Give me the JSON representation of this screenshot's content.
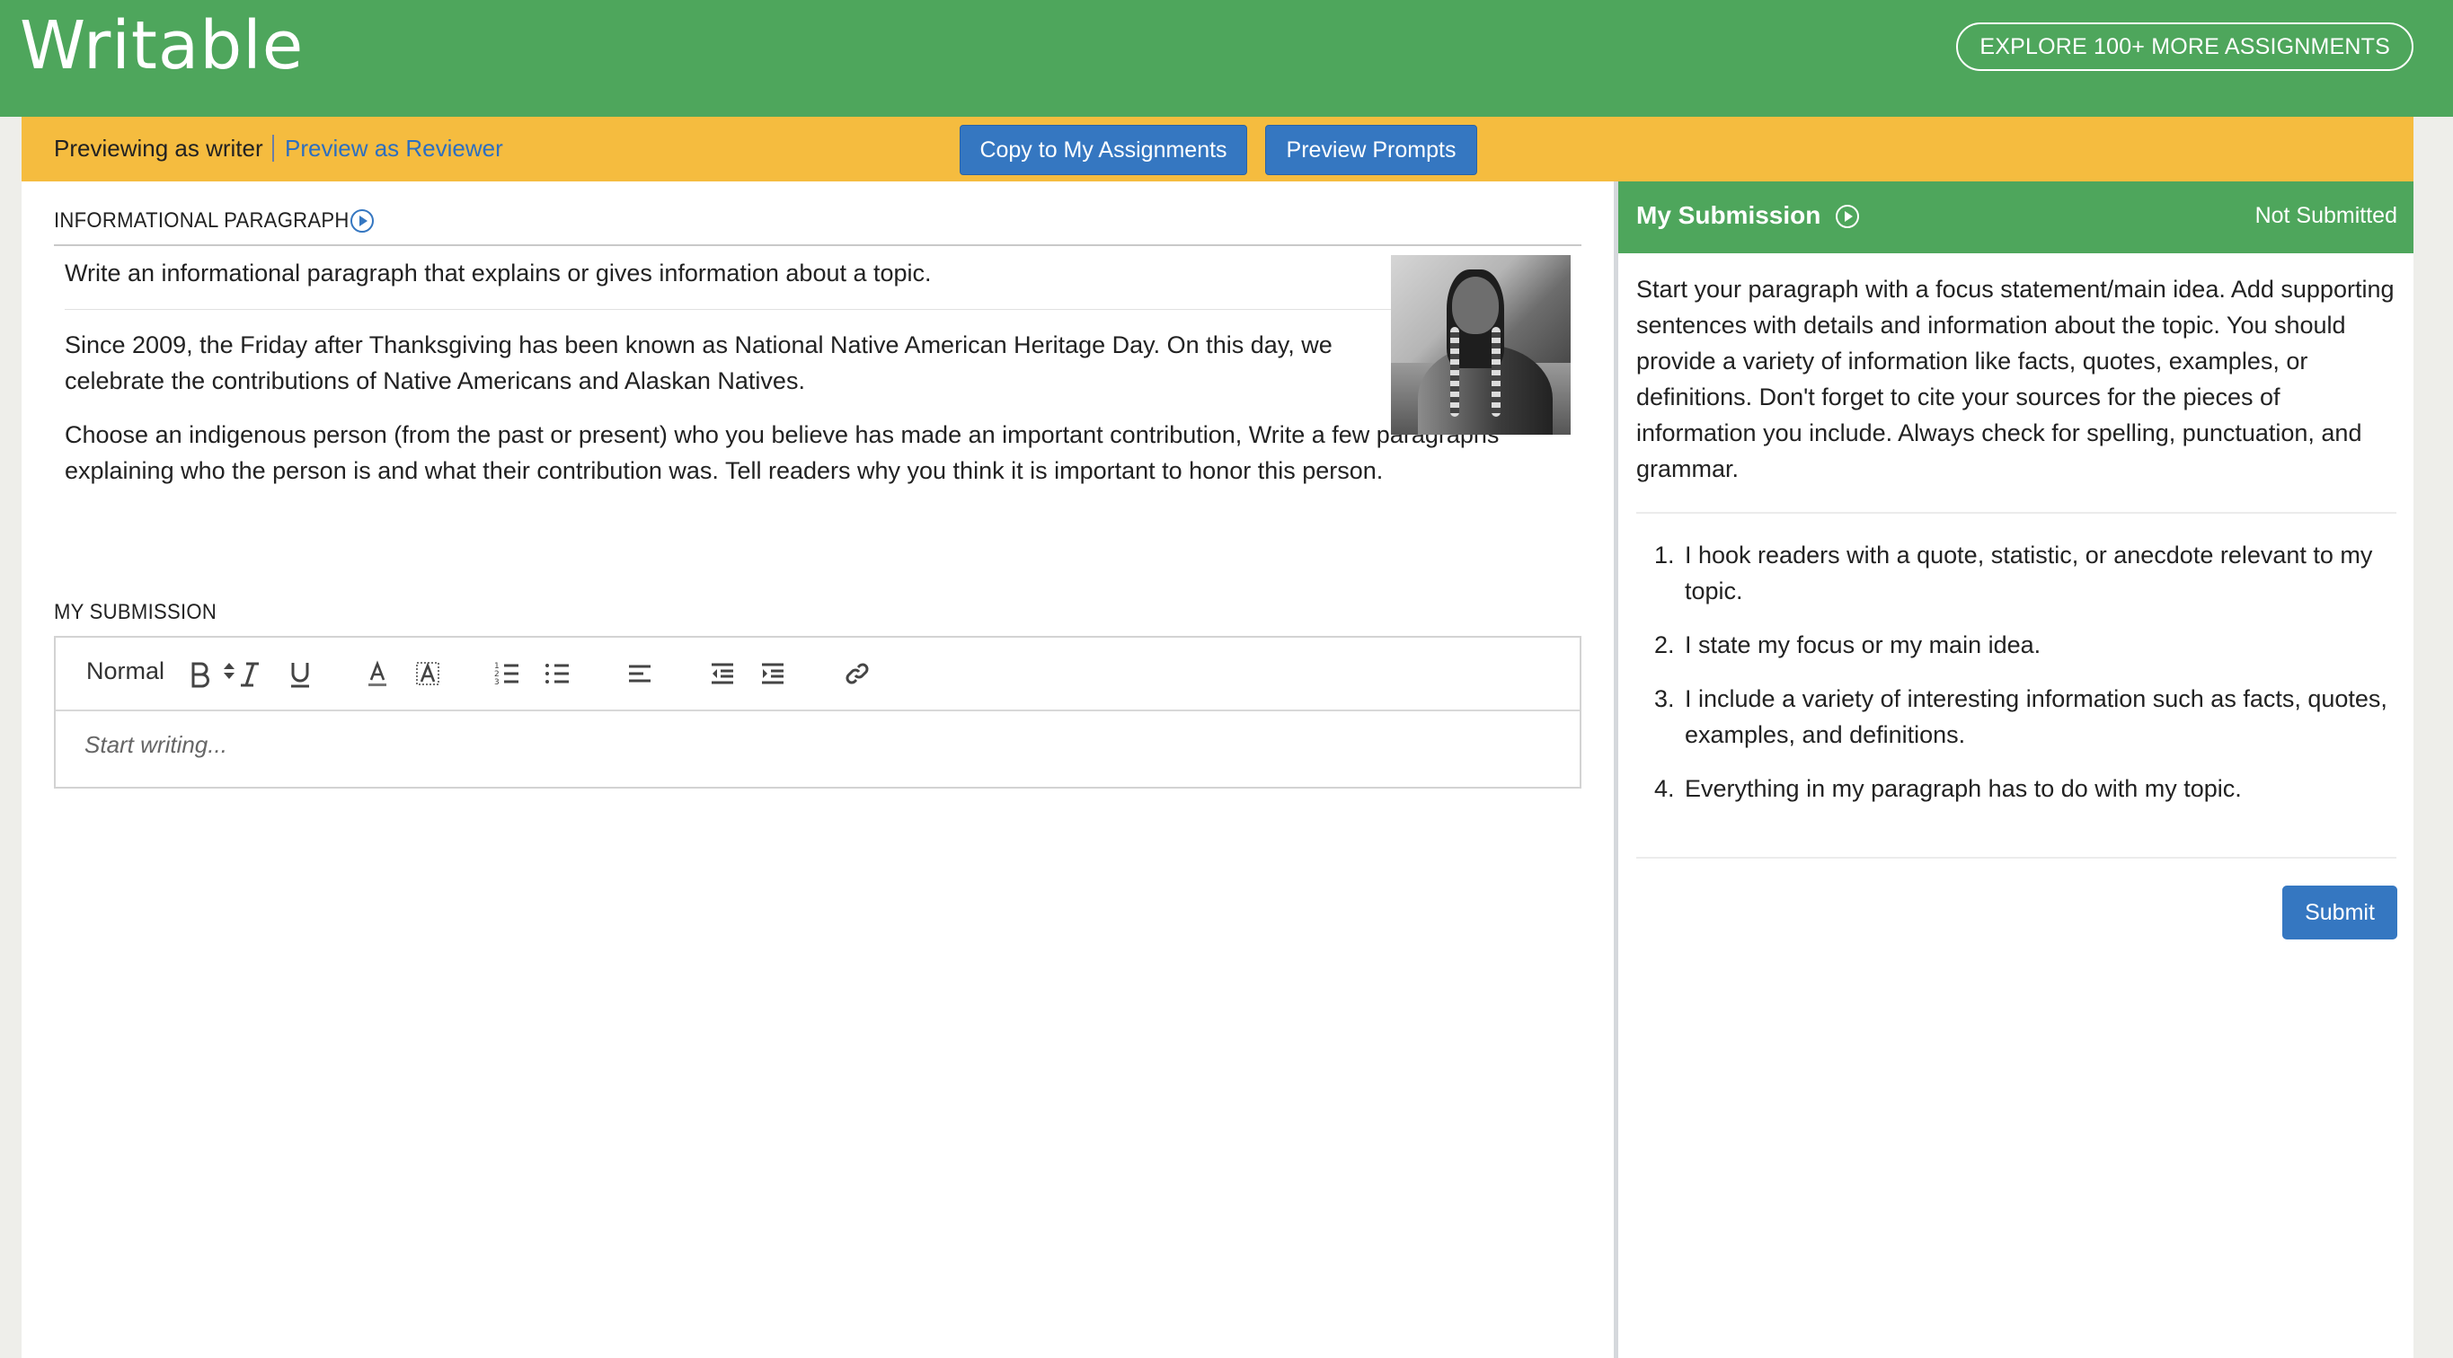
{
  "header": {
    "logo": "Writable",
    "explore_label": "EXPLORE 100+ MORE ASSIGNMENTS"
  },
  "preview_bar": {
    "previewing_text": "Previewing as writer",
    "reviewer_link": "Preview as Reviewer",
    "copy_button": "Copy to My Assignments",
    "prompts_button": "Preview Prompts"
  },
  "assignment": {
    "title": "INFORMATIONAL PARAGRAPH",
    "paragraphs": [
      "Write an informational paragraph that explains or gives information about a topic.",
      "Since 2009, the Friday after Thanksgiving has been known as National Native American Heritage Day. On this day, we celebrate the contributions of Native Americans and Alaskan Natives.",
      "Choose an indigenous person (from the past or present) who you believe has made an important contribution, Write a few paragraphs explaining who the person is and what their contribution was. Tell readers why you think it is important to honor this person."
    ]
  },
  "submission": {
    "title": "MY SUBMISSION",
    "format_select": "Normal",
    "placeholder": "Start writing..."
  },
  "right_panel": {
    "title": "My Submission",
    "status": "Not Submitted",
    "instructions": "Start your paragraph with a focus statement/main idea. Add supporting sentences with details and information about the topic. You should provide a variety of information like facts, quotes, examples, or definitions. Don't forget to cite your sources for the pieces of information you include. Always check for spelling, punctuation, and grammar.",
    "checklist": [
      "I hook readers with a quote, statistic, or anecdote relevant to my topic.",
      "I state my focus or my main idea.",
      "I include a variety of interesting information such as facts, quotes, examples, and definitions.",
      "Everything in my paragraph has to do with my topic."
    ],
    "submit_label": "Submit"
  },
  "colors": {
    "brand_green": "#4ea65c",
    "preview_yellow": "#f5bc3f",
    "button_blue": "#3577c1"
  },
  "icons": [
    "play-circle-icon",
    "bold-icon",
    "italic-icon",
    "underline-icon",
    "text-color-icon",
    "highlight-icon",
    "ordered-list-icon",
    "bullet-list-icon",
    "align-left-icon",
    "outdent-icon",
    "indent-icon",
    "link-icon",
    "select-arrows-icon"
  ]
}
